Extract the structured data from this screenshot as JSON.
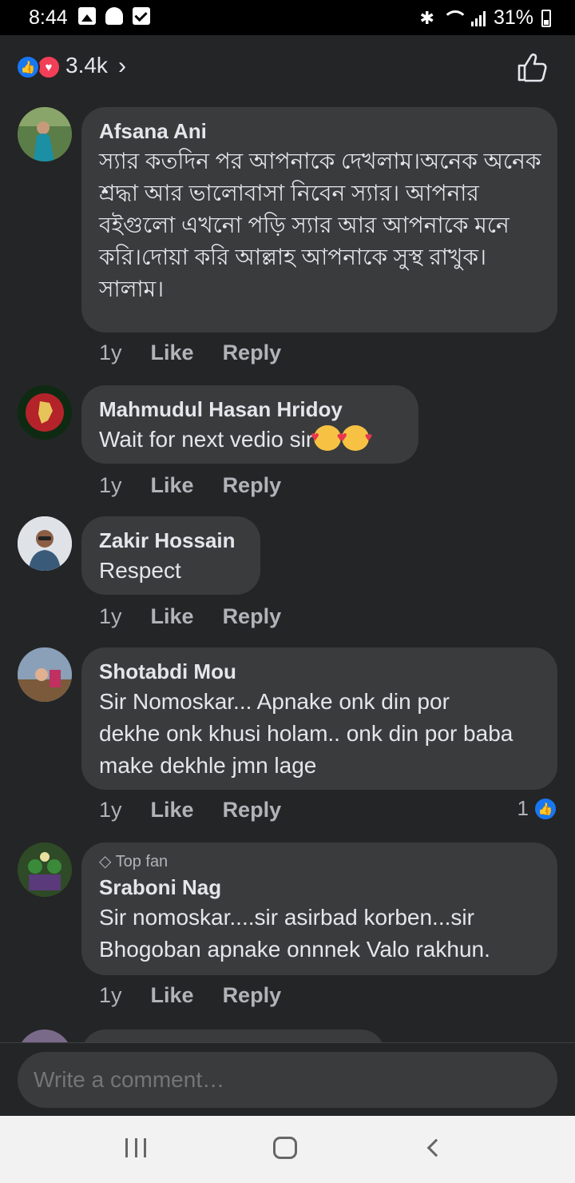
{
  "status_bar": {
    "time": "8:44",
    "battery": "31%",
    "icons": [
      "gallery-icon",
      "snapchat-icon",
      "check-icon",
      "bluetooth-icon",
      "wifi-icon",
      "signal-icon",
      "battery-icon"
    ]
  },
  "reactions": {
    "count": "3.4k",
    "icons": [
      "like-reaction-icon",
      "love-reaction-icon"
    ],
    "colors": {
      "like": "#1877f2",
      "love": "#f33e58"
    }
  },
  "comments": [
    {
      "name": "Afsana Ani",
      "text": "স্যার কতদিন পর আপনাকে দেখলাম।অনেক অনেক শ্রদ্ধা আর ভালোবাসা নিবেন স্যার। আপনার বইগুলো এখনো পড়ি স্যার আর আপনাকে মনে করি।দোয়া করি আল্লাহ আপনাকে সুস্থ রাখুক।সালাম।",
      "age": "1y",
      "like": "Like",
      "reply": "Reply"
    },
    {
      "name": "Mahmudul Hasan Hridoy",
      "text": "Wait for next vedio sir",
      "emoji": "smiling-face-with-hearts",
      "age": "1y",
      "like": "Like",
      "reply": "Reply"
    },
    {
      "name": "Zakir Hossain",
      "text": "Respect",
      "age": "1y",
      "like": "Like",
      "reply": "Reply"
    },
    {
      "name": "Shotabdi Mou",
      "text": "Sir Nomoskar... Apnake onk din por dekhe onk khusi holam.. onk din por baba make dekhle jmn lage",
      "age": "1y",
      "like": "Like",
      "reply": "Reply",
      "likes": "1"
    },
    {
      "badge": "Top fan",
      "name": "Sraboni Nag",
      "text": "Sir nomoskar....sir asirbad korben...sir Bhogoban apnake onnnek Valo rakhun.",
      "age": "1y",
      "like": "Like",
      "reply": "Reply"
    }
  ],
  "composer": {
    "placeholder": "Write a comment…"
  },
  "theme": {
    "background": "#242526",
    "bubble": "#3a3b3c",
    "text": "#e4e6eb",
    "secondary": "#b0b3b8"
  }
}
